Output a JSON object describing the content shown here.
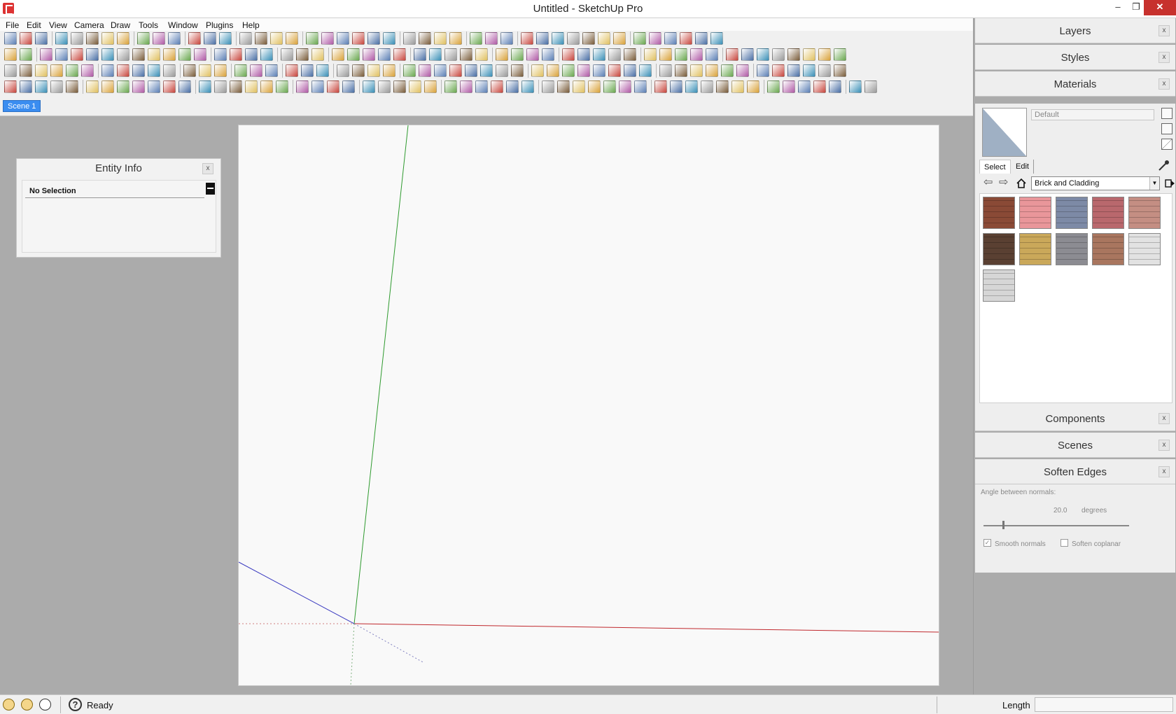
{
  "window": {
    "title": "Untitled - SketchUp Pro",
    "controls": {
      "minimize": "–",
      "maximize": "❐",
      "close": "✕"
    }
  },
  "menubar": [
    "File",
    "Edit",
    "View",
    "Camera",
    "Draw",
    "Tools",
    "Window",
    "Plugins",
    "Help"
  ],
  "scene_tab": "Scene 1",
  "entity_info": {
    "title": "Entity Info",
    "close": "x",
    "selection": "No Selection"
  },
  "tray": {
    "panels": {
      "layers": "Layers",
      "styles": "Styles",
      "materials": "Materials",
      "components": "Components",
      "scenes": "Scenes",
      "soften_edges": "Soften Edges"
    },
    "close": "x"
  },
  "materials": {
    "current_name": "Default",
    "tabs": [
      "Select",
      "Edit"
    ],
    "library": "Brick and Cladding",
    "swatch_colors": [
      "#8a4a36",
      "#e9969a",
      "#7d8aa6",
      "#b9686d",
      "#c48e83",
      "#5a4032",
      "#caa85a",
      "#8c8c92",
      "#a9765f",
      "#e2e2e2",
      "#d6d6d6"
    ]
  },
  "soften_edges": {
    "angle_label": "Angle between normals:",
    "angle_value": "20.0",
    "angle_unit": "degrees",
    "slider_fraction": 0.13,
    "smooth_normals_label": "Smooth normals",
    "smooth_normals_checked": true,
    "soften_coplanar_label": "Soften coplanar",
    "soften_coplanar_checked": false
  },
  "status": {
    "text": "Ready",
    "measurement_label": "Length",
    "measurement_value": ""
  },
  "axes": {
    "x_color": "#c0282d",
    "y_color": "#2e9a2e",
    "z_color": "#3a3ac0"
  }
}
